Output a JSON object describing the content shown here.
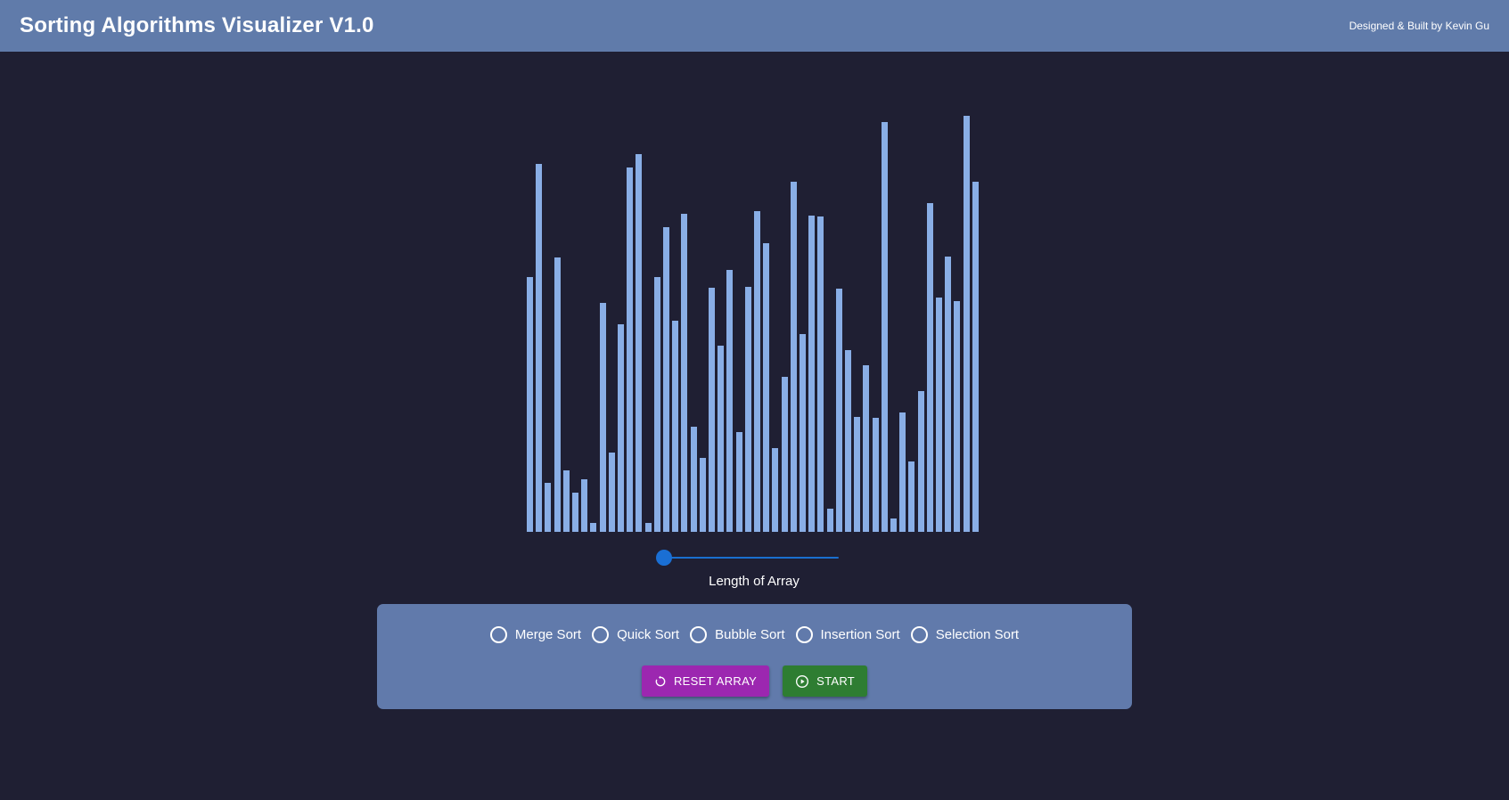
{
  "header": {
    "title": "Sorting Algorithms Visualizer V1.0",
    "credit": "Designed & Built by Kevin Gu"
  },
  "array": {
    "max_value": 441,
    "values": [
      270,
      390,
      52,
      291,
      65,
      42,
      56,
      9,
      243,
      84,
      220,
      386,
      400,
      9,
      270,
      323,
      224,
      337,
      111,
      78,
      259,
      197,
      278,
      106,
      260,
      340,
      306,
      89,
      164,
      371,
      210,
      335,
      334,
      25,
      258,
      193,
      122,
      177,
      121,
      434,
      14,
      127,
      75,
      149,
      348,
      248,
      292,
      245,
      441,
      371
    ]
  },
  "slider": {
    "label": "Length of Array",
    "value_fraction": 0.0
  },
  "algorithms": {
    "options": [
      "Merge Sort",
      "Quick Sort",
      "Bubble Sort",
      "Insertion Sort",
      "Selection Sort"
    ],
    "selected": null
  },
  "buttons": {
    "reset_label": "RESET ARRAY",
    "reset_icon": "reset-icon",
    "start_label": "START",
    "start_icon": "play-circle-icon"
  },
  "colors": {
    "header_bg": "#607baa",
    "page_bg": "#1f1f33",
    "bar": "#89aee6",
    "slider": "#1a6fcf",
    "panel_bg": "#617aab",
    "reset_button": "#9c27b0",
    "start_button": "#2e7d32"
  }
}
